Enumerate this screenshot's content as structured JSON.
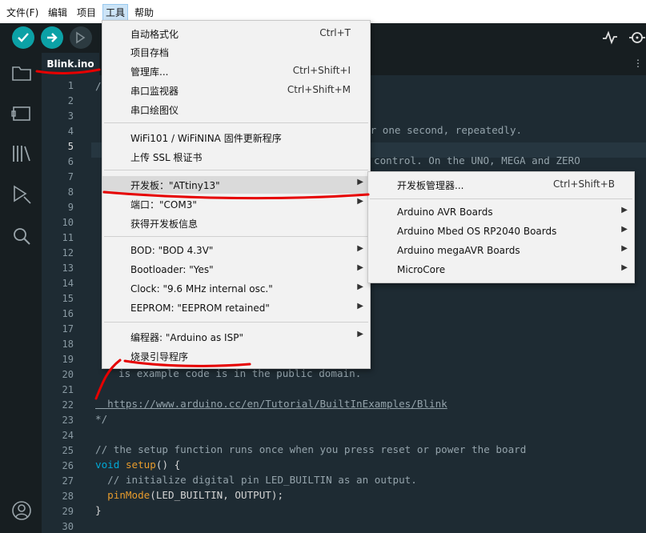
{
  "menubar": {
    "items": [
      {
        "label": "文件(F)"
      },
      {
        "label": "编辑"
      },
      {
        "label": "项目"
      },
      {
        "label": "工具"
      },
      {
        "label": "帮助"
      }
    ]
  },
  "toolbar": {
    "verify_icon": "check-icon",
    "upload_icon": "arrow-right-icon",
    "debug_icon": "debug-icon"
  },
  "tab": {
    "label": "Blink.ino"
  },
  "line_numbers": [
    "1",
    "2",
    "3",
    "4",
    "5",
    "6",
    "7",
    "8",
    "9",
    "10",
    "11",
    "12",
    "13",
    "14",
    "15",
    "16",
    "17",
    "18",
    "19",
    "20",
    "21",
    "22",
    "23",
    "24",
    "25",
    "26",
    "27",
    "28",
    "29",
    "30"
  ],
  "code": {
    "l1": "/",
    "l4_frag": "or one second, repeatedly.",
    "l6_frag": "control. On the UNO, MEGA and ZERO",
    "l20_frag": "is example code is in the public domain.",
    "l22": "  https://www.arduino.cc/en/Tutorial/BuiltInExamples/Blink",
    "l23": "*/",
    "l25": "// the setup function runs once when you press reset or power the board",
    "l26_kw": "void",
    "l26_fn": "setup",
    "l26_rest": "() {",
    "l27": "  // initialize digital pin LED_BUILTIN as an output.",
    "l28_fn": "pinMode",
    "l28_rest": "(LED_BUILTIN, OUTPUT);",
    "l29": "}"
  },
  "tools_menu": {
    "items": [
      {
        "label": "自动格式化",
        "shortcut": "Ctrl+T"
      },
      {
        "label": "项目存档",
        "shortcut": ""
      },
      {
        "label": "管理库...",
        "shortcut": "Ctrl+Shift+I"
      },
      {
        "label": "串口监视器",
        "shortcut": "Ctrl+Shift+M"
      },
      {
        "label": "串口绘图仪",
        "shortcut": ""
      },
      {
        "label": "WiFi101 / WiFiNINA 固件更新程序",
        "shortcut": ""
      },
      {
        "label": "上传 SSL 根证书",
        "shortcut": ""
      },
      {
        "label": "开发板：\"ATtiny13\"",
        "shortcut": ""
      },
      {
        "label": "端口：\"COM3\"",
        "shortcut": ""
      },
      {
        "label": "获得开发板信息",
        "shortcut": ""
      },
      {
        "label": "BOD: \"BOD 4.3V\"",
        "shortcut": ""
      },
      {
        "label": "Bootloader: \"Yes\"",
        "shortcut": ""
      },
      {
        "label": "Clock: \"9.6 MHz internal osc.\"",
        "shortcut": ""
      },
      {
        "label": "EEPROM: \"EEPROM retained\"",
        "shortcut": ""
      },
      {
        "label": "编程器: \"Arduino as ISP\"",
        "shortcut": ""
      },
      {
        "label": "烧录引导程序",
        "shortcut": ""
      }
    ]
  },
  "board_submenu": {
    "items": [
      {
        "label": "开发板管理器...",
        "shortcut": "Ctrl+Shift+B"
      },
      {
        "label": "Arduino AVR Boards"
      },
      {
        "label": "Arduino Mbed OS RP2040 Boards"
      },
      {
        "label": "Arduino megaAVR Boards"
      },
      {
        "label": "MicroCore"
      }
    ]
  },
  "colors": {
    "accent_teal": "#0ca1a6",
    "editor_bg": "#1e2b33",
    "annotation_red": "#e60000"
  }
}
